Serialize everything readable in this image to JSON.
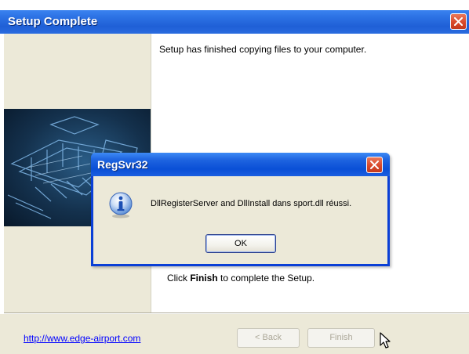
{
  "setup_window": {
    "title": "Setup Complete",
    "message": "Setup has finished copying files to your computer.",
    "finish_instruction": {
      "prefix": "Click ",
      "emphasis": "Finish",
      "suffix": " to complete the Setup."
    },
    "link": "http://www.edge-airport.com",
    "buttons": {
      "back": "< Back",
      "finish": "Finish"
    }
  },
  "dialog": {
    "title": "RegSvr32",
    "message": "DllRegisterServer and DllInstall dans sport.dll réussi.",
    "ok_label": "OK"
  },
  "icons": {
    "close": "close-icon",
    "info": "info-icon",
    "cursor": "cursor-icon",
    "banner": "banner-image"
  },
  "colors": {
    "titlebar": "#2a6fe2",
    "dialog_border": "#0a3fd6",
    "close_button": "#d9492b",
    "window_face": "#ece9d8",
    "link": "#0000ff",
    "disabled_text": "#aca899"
  }
}
